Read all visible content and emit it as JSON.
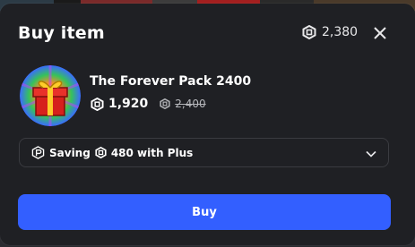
{
  "modal": {
    "title": "Buy item",
    "balance": "2,380",
    "balance_icon": "robux-icon",
    "close_icon": "close-icon"
  },
  "item": {
    "name": "The Forever Pack 2400",
    "image_icon": "gift-box-icon",
    "price": "1,920",
    "original_price": "2,400"
  },
  "plus_offer": {
    "saving_label": "Saving",
    "saving_amount": "480 with Plus",
    "icon": "premium-icon",
    "chevron": "chevron-down-icon"
  },
  "buy_button": {
    "label": "Buy"
  },
  "colors": {
    "accent": "#335fff",
    "modal_bg": "#1f2024"
  }
}
